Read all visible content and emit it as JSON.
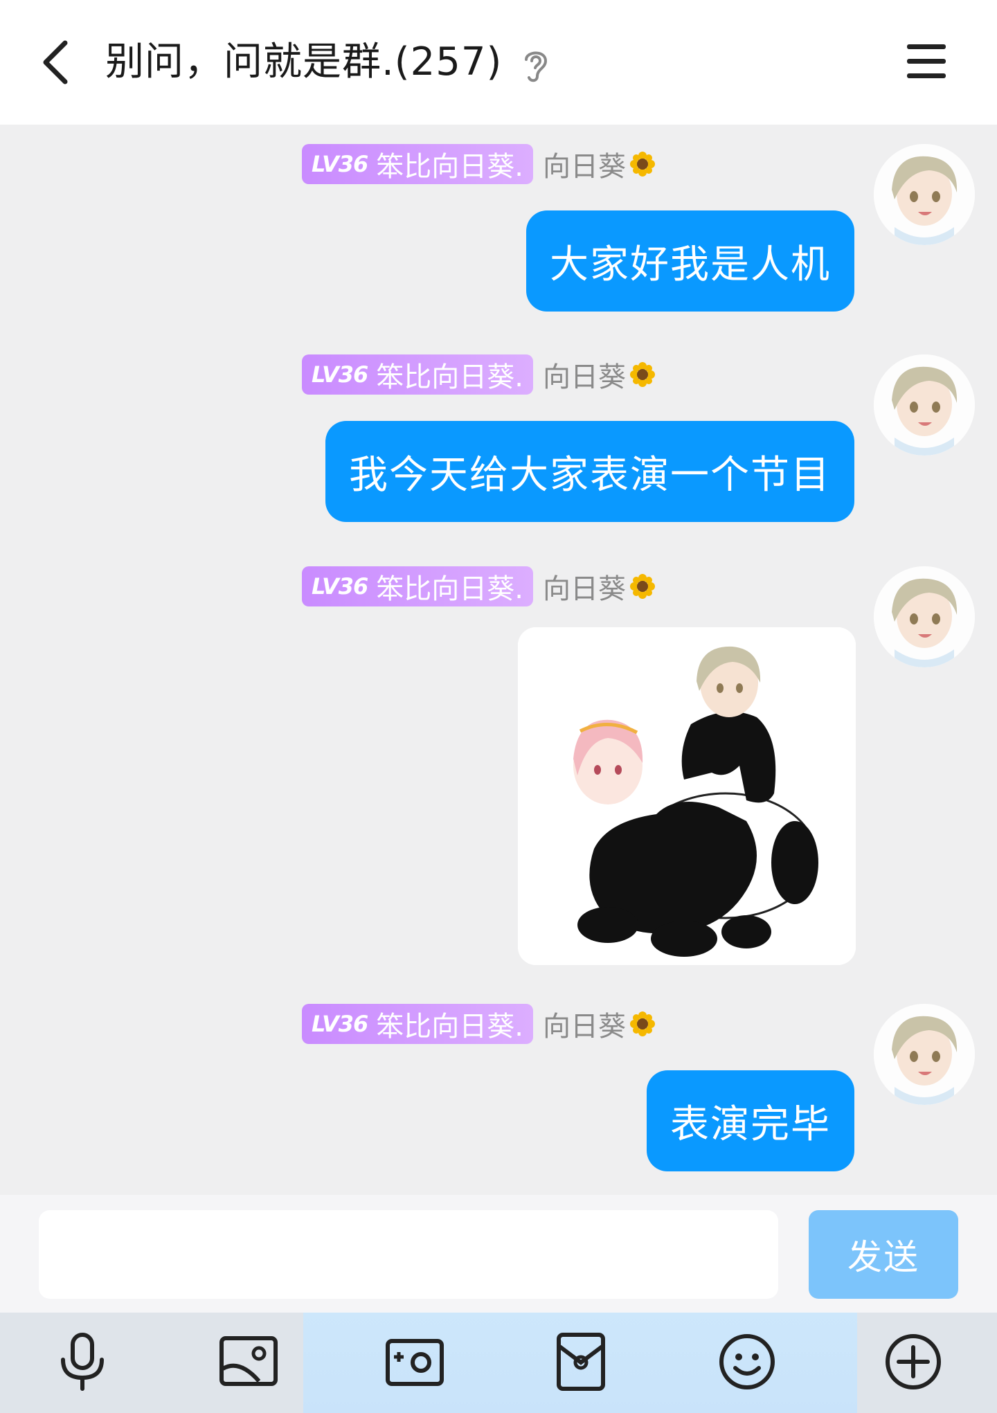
{
  "header": {
    "title": "别问，问就是群.(257)",
    "back_icon": "chevron-left-icon",
    "ear_icon": "ear-icon",
    "menu_icon": "hamburger-menu-icon"
  },
  "messages": [
    {
      "level": "LV36",
      "title_badge": "笨比向日葵.",
      "sender": "向日葵",
      "type": "text",
      "text": "大家好我是人机"
    },
    {
      "level": "LV36",
      "title_badge": "笨比向日葵.",
      "sender": "向日葵",
      "type": "text",
      "text": "我今天给大家表演一个节目"
    },
    {
      "level": "LV36",
      "title_badge": "笨比向日葵.",
      "sender": "向日葵",
      "type": "image"
    },
    {
      "level": "LV36",
      "title_badge": "笨比向日葵.",
      "sender": "向日葵",
      "type": "text",
      "text": "表演完毕"
    }
  ],
  "input": {
    "value": "",
    "send_label": "发送"
  },
  "toolbar": {
    "items": [
      "microphone-icon",
      "image-icon",
      "camera-icon",
      "red-packet-icon",
      "emoji-icon",
      "plus-icon"
    ]
  },
  "colors": {
    "bubble": "#0a99ff",
    "badge": "#c98bff",
    "send_button": "#7cc4fb",
    "background": "#efeff0"
  }
}
